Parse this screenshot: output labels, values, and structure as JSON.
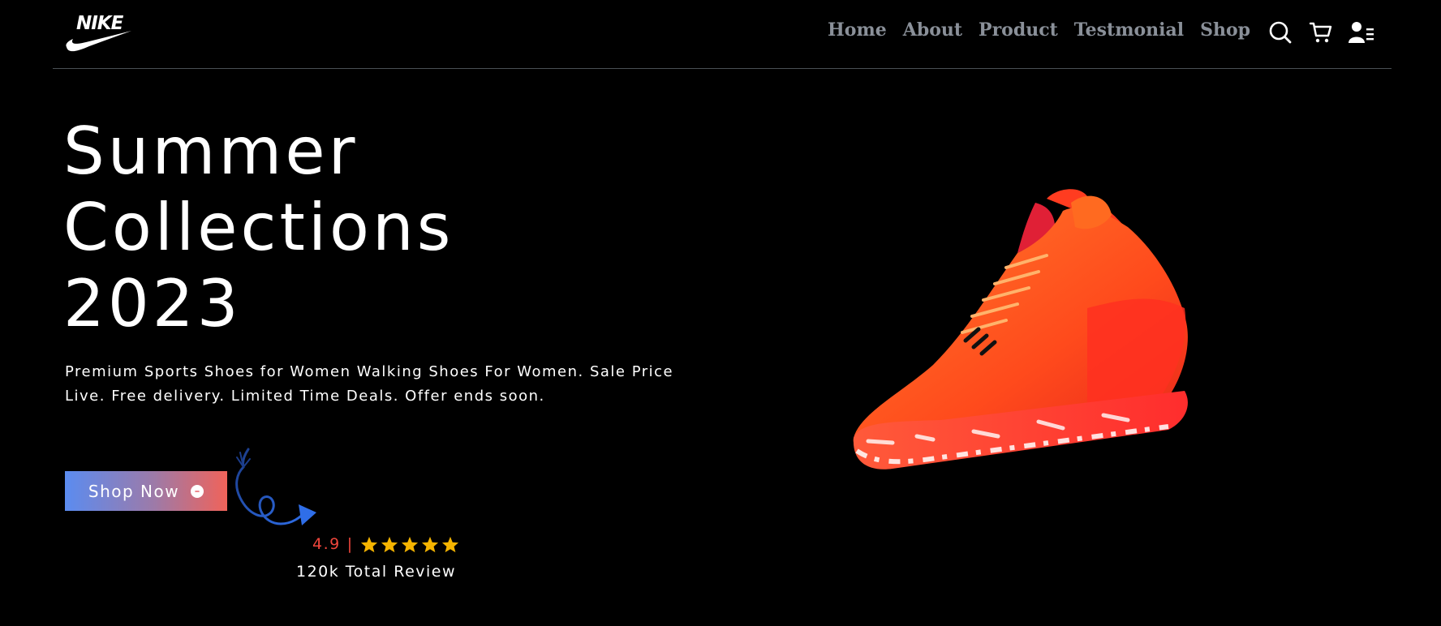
{
  "header": {
    "logo_text": "NIKE",
    "nav": [
      "Home",
      "About",
      "Product",
      "Testmonial",
      "Shop"
    ],
    "icons": [
      "search-icon",
      "cart-icon",
      "user-menu-icon"
    ]
  },
  "hero": {
    "title_lines": [
      "Summer",
      "Collections",
      "2023"
    ],
    "description": "Premium Sports Shoes for Women Walking Shoes For Women. Sale Price Live. Free delivery. Limited Time Deals. Offer ends soon.",
    "cta_label": "Shop Now",
    "rating": "4.9",
    "rating_separator": "|",
    "stars": 5,
    "review_text": "120k Total Review",
    "image": "red-orange basketball shoe"
  },
  "colors": {
    "background": "#000000",
    "nav_text": "#8a9099",
    "accent_red": "#f0463c",
    "star": "#f5b400",
    "button_gradient_start": "#5b8cf0",
    "button_gradient_end": "#f0635a",
    "shoe": "#ff4a1c"
  }
}
